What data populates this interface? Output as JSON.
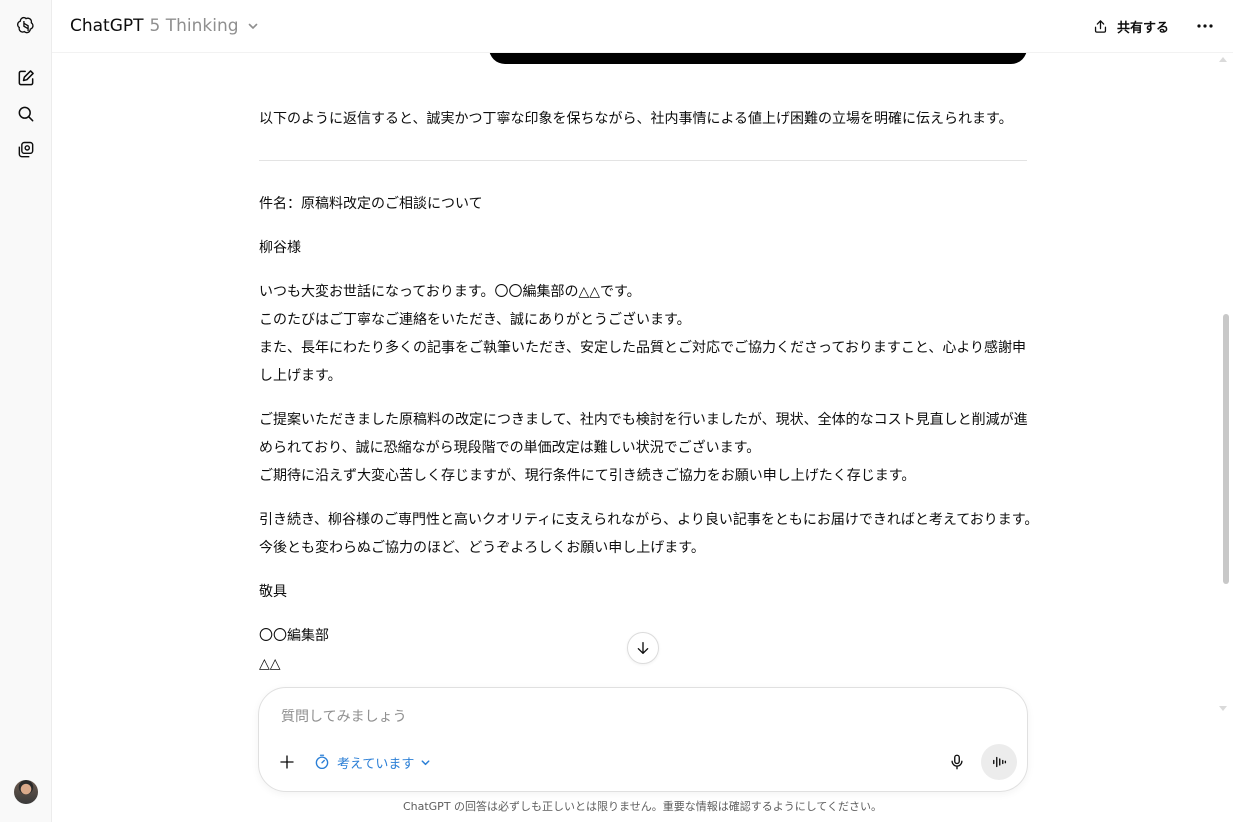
{
  "header": {
    "app_name": "ChatGPT",
    "model_variant": "5 Thinking",
    "share_label": "共有する"
  },
  "icons": {
    "logo": "openai-logo-icon",
    "new_chat": "new-chat-icon",
    "search": "search-icon",
    "library": "library-icon",
    "share": "share-icon",
    "more": "more-icon",
    "plus": "plus-icon",
    "timer": "timer-icon",
    "mic": "microphone-icon",
    "voice": "voice-mode-icon",
    "scroll_down": "arrow-down-icon"
  },
  "message": {
    "intro": "以下のように返信すると、誠実かつ丁寧な印象を保ちながら、社内事情による値上げ困難の立場を明確に伝えられます。",
    "subject": "件名：原稿料改定のご相談について",
    "greeting": "柳谷様",
    "para1": [
      "いつも大変お世話になっております。〇〇編集部の△△です。",
      "このたびはご丁寧なご連絡をいただき、誠にありがとうございます。",
      "また、長年にわたり多くの記事をご執筆いただき、安定した品質とご対応でご協力くださっておりますこと、心より感謝申し上げます。"
    ],
    "para2": [
      "ご提案いただきました原稿料の改定につきまして、社内でも検討を行いましたが、現状、全体的なコスト見直しと削減が進められており、誠に恐縮ながら現段階での単価改定は難しい状況でございます。",
      "ご期待に沿えず大変心苦しく存じますが、現行条件にて引き続きご協力をお願い申し上げたく存じます。"
    ],
    "para3": [
      "引き続き、柳谷様のご専門性と高いクオリティに支えられながら、より良い記事をともにお届けできればと考えております。",
      "今後とも変わらぬご協力のほど、どうぞよろしくお願い申し上げます。"
    ],
    "closing": "敬具",
    "signature": [
      "〇〇編集部",
      "△△"
    ]
  },
  "composer": {
    "placeholder": "質問してみましょう",
    "mode_label": "考えています"
  },
  "disclaimer": "ChatGPT の回答は必ずしも正しいとは限りません。重要な情報は確認するようにしてください。",
  "colors": {
    "accent": "#2b7fd6",
    "rail_bg": "#f9f9f9"
  }
}
